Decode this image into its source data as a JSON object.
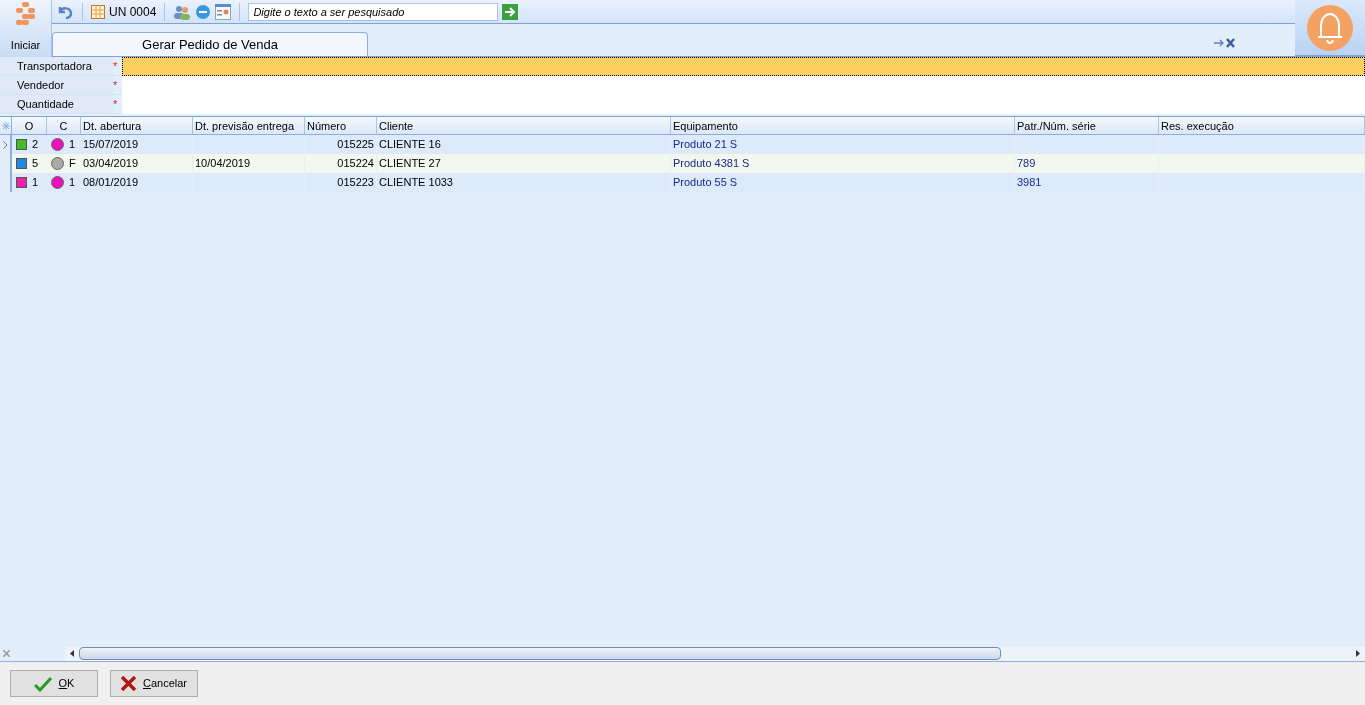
{
  "toolbar": {
    "start_label": "Iniciar",
    "unit": "UN 0004",
    "search": {
      "placeholder": "Digite o texto a ser pesquisado"
    }
  },
  "tabs": [
    {
      "label": "Gerar Pedido de Venda",
      "selected": true
    }
  ],
  "form": [
    {
      "label": "Transportadora",
      "mark": "*",
      "focused": true
    },
    {
      "label": "Vendedor",
      "mark": "*",
      "focused": false
    },
    {
      "label": "Quantidade",
      "mark": "*",
      "focused": false
    }
  ],
  "table": {
    "columns": [
      "O",
      "C",
      "Dt. abertura",
      "Dt. previsão entrega",
      "Número",
      "Cliente",
      "Equipamento",
      "Patr./Núm. série",
      "Res. execução"
    ],
    "rows": [
      {
        "selected": true,
        "o": {
          "text": "2",
          "color": "#44bb22"
        },
        "c": {
          "text": "1",
          "color": "#ee11bb"
        },
        "dt_abertura": "15/07/2019",
        "dt_previsao": "",
        "numero": "015225",
        "cliente": "CLIENTE  16",
        "equipamento": "Produto 21 S",
        "patr": "",
        "res": ""
      },
      {
        "selected": false,
        "o": {
          "text": "5",
          "color": "#2288dd"
        },
        "c": {
          "text": "F",
          "color": "#aaaaaa"
        },
        "dt_abertura": "03/04/2019",
        "dt_previsao": "10/04/2019",
        "numero": "015224",
        "cliente": "CLIENTE  27",
        "equipamento": "Produto 4381 S",
        "patr": "789",
        "res": ""
      },
      {
        "selected": false,
        "o": {
          "text": "1",
          "color": "#ee22aa"
        },
        "c": {
          "text": "1",
          "color": "#ee11bb"
        },
        "dt_abertura": "08/01/2019",
        "dt_previsao": "",
        "numero": "015223",
        "cliente": "CLIENTE  1033",
        "equipamento": "Produto 55 S",
        "patr": "3981",
        "res": ""
      }
    ]
  },
  "buttons": [
    {
      "kind": "ok",
      "label": "OK"
    },
    {
      "kind": "cancel",
      "label": "Cancelar"
    }
  ]
}
